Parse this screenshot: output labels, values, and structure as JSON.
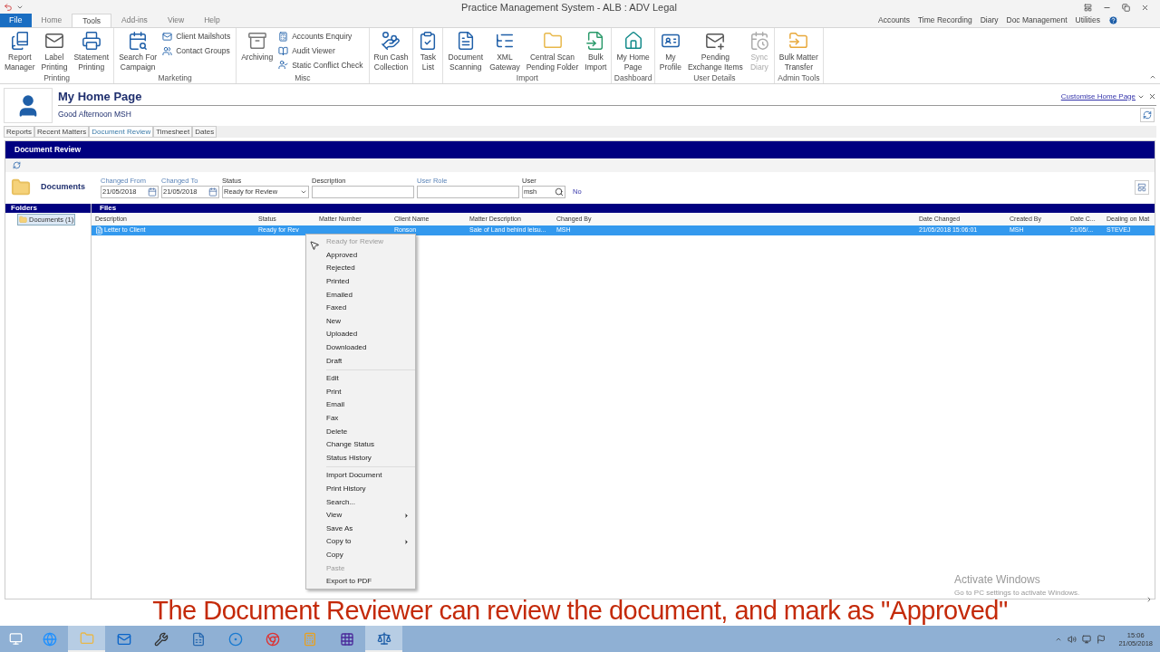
{
  "window": {
    "title": "Practice Management System - ALB : ADV Legal"
  },
  "menu_tabs": [
    {
      "label": "File",
      "kind": "file",
      "selected": false
    },
    {
      "label": "Home",
      "kind": "tab",
      "selected": false
    },
    {
      "label": "Tools",
      "kind": "tab",
      "selected": true
    },
    {
      "label": "Add-ins",
      "kind": "tab",
      "selected": false
    },
    {
      "label": "View",
      "kind": "tab",
      "selected": false
    },
    {
      "label": "Help",
      "kind": "tab",
      "selected": false
    }
  ],
  "right_links": [
    "Accounts",
    "Time Recording",
    "Diary",
    "Doc Management",
    "Utilities"
  ],
  "ribbon": [
    {
      "label": "Printing",
      "items": [
        {
          "kind": "large",
          "label": "Report\nManager",
          "disabled": false
        },
        {
          "kind": "large",
          "label": "Label\nPrinting",
          "disabled": false
        },
        {
          "kind": "large",
          "label": "Statement\nPrinting",
          "disabled": false
        }
      ]
    },
    {
      "label": "Marketing",
      "items": [
        {
          "kind": "large",
          "label": "Search For\nCampaign",
          "disabled": false
        },
        {
          "kind": "stack",
          "items": [
            "Client Mailshots",
            "Contact Groups"
          ]
        }
      ]
    },
    {
      "label": "Misc",
      "items": [
        {
          "kind": "large",
          "label": "Archiving",
          "disabled": false
        },
        {
          "kind": "stack",
          "items": [
            "Accounts Enquiry",
            "Audit Viewer",
            "Static Conflict Check"
          ]
        }
      ]
    },
    {
      "items": [
        {
          "kind": "large",
          "label": "Run Cash\nCollection",
          "disabled": false
        }
      ]
    },
    {
      "items": [
        {
          "kind": "large",
          "label": "Task\nList",
          "disabled": false
        }
      ]
    },
    {
      "label": "Import",
      "items": [
        {
          "kind": "large",
          "label": "Document\nScanning",
          "disabled": false
        },
        {
          "kind": "large",
          "label": "XML\nGateway",
          "disabled": false
        },
        {
          "kind": "large",
          "label": "Central Scan\nPending Folder",
          "disabled": false
        },
        {
          "kind": "large",
          "label": "Bulk\nImport",
          "disabled": false
        }
      ]
    },
    {
      "label": "Dashboard",
      "items": [
        {
          "kind": "large",
          "label": "My Home\nPage",
          "disabled": false
        }
      ]
    },
    {
      "label": "User Details",
      "items": [
        {
          "kind": "large",
          "label": "My\nProfile",
          "disabled": false
        },
        {
          "kind": "large",
          "label": "Pending\nExchange Items",
          "disabled": false
        },
        {
          "kind": "large",
          "label": "Sync\nDiary",
          "disabled": true
        }
      ]
    },
    {
      "label": "Admin Tools",
      "items": [
        {
          "kind": "large",
          "label": "Bulk Matter\nTransfer",
          "disabled": false
        }
      ]
    }
  ],
  "home": {
    "title": "My Home Page",
    "greeting": "Good Afternoon MSH",
    "customise_link": "Customise Home Page"
  },
  "home_tabs": [
    {
      "label": "Reports",
      "selected": false
    },
    {
      "label": "Recent Matters",
      "selected": false
    },
    {
      "label": "Document Review",
      "selected": true
    },
    {
      "label": "Timesheet",
      "selected": false
    },
    {
      "label": "Dates",
      "selected": false
    }
  ],
  "review": {
    "title": "Document Review",
    "documents_label": "Documents",
    "filters": [
      {
        "label": "Changed From",
        "kind": "date",
        "value": "21/05/2018",
        "enabled": true
      },
      {
        "label": "Changed To",
        "kind": "date",
        "value": "21/05/2018",
        "enabled": true
      },
      {
        "label": "Status",
        "kind": "select",
        "value": "Ready for Review",
        "enabled": false
      },
      {
        "label": "Description",
        "kind": "text",
        "enabled": false
      },
      {
        "label": "User Role",
        "kind": "text",
        "enabled": true
      },
      {
        "label": "User",
        "kind": "search",
        "value": "msh",
        "enabled": false
      }
    ],
    "no_link": "No",
    "folders_title": "Folders",
    "folders": [
      {
        "label": "Documents (1)",
        "selected": true
      }
    ],
    "files_title": "Files",
    "columns": [
      "Description",
      "Status",
      "Matter Number",
      "Client Name",
      "Matter Description",
      "Changed By",
      "Date Changed",
      "Created By",
      "Date C...",
      "Dealing on Mat"
    ],
    "rows": [
      {
        "selected": true,
        "cells": [
          "Letter to Client",
          "Ready for Rev",
          null,
          "Ronson",
          "Sale of Land behind leisu...",
          "MSH",
          "21/05/2018 15:06:01",
          "MSH",
          "21/05/...",
          "STEVEJ"
        ]
      }
    ]
  },
  "context_menu": [
    {
      "kind": "item",
      "label": "Ready for Review",
      "disabled": true,
      "submenu": false
    },
    {
      "kind": "item",
      "label": "Approved",
      "disabled": false,
      "submenu": false
    },
    {
      "kind": "item",
      "label": "Rejected",
      "disabled": false,
      "submenu": false
    },
    {
      "kind": "item",
      "label": "Printed",
      "disabled": false,
      "submenu": false
    },
    {
      "kind": "item",
      "label": "Emailed",
      "disabled": false,
      "submenu": false
    },
    {
      "kind": "item",
      "label": "Faxed",
      "disabled": false,
      "submenu": false
    },
    {
      "kind": "item",
      "label": "New",
      "disabled": false,
      "submenu": false
    },
    {
      "kind": "item",
      "label": "Uploaded",
      "disabled": false,
      "submenu": false
    },
    {
      "kind": "item",
      "label": "Downloaded",
      "disabled": false,
      "submenu": false
    },
    {
      "kind": "item",
      "label": "Draft",
      "disabled": false,
      "submenu": false
    },
    {
      "kind": "separator"
    },
    {
      "kind": "item",
      "label": "Edit",
      "disabled": false,
      "submenu": false
    },
    {
      "kind": "item",
      "label": "Print",
      "disabled": false,
      "submenu": false
    },
    {
      "kind": "item",
      "label": "Email",
      "disabled": false,
      "submenu": false
    },
    {
      "kind": "item",
      "label": "Fax",
      "disabled": false,
      "submenu": false
    },
    {
      "kind": "item",
      "label": "Delete",
      "disabled": false,
      "submenu": false
    },
    {
      "kind": "item",
      "label": "Change Status",
      "disabled": false,
      "submenu": false
    },
    {
      "kind": "item",
      "label": "Status History",
      "disabled": false,
      "submenu": false
    },
    {
      "kind": "separator"
    },
    {
      "kind": "item",
      "label": "Import Document",
      "disabled": false,
      "submenu": false
    },
    {
      "kind": "item",
      "label": "Print History",
      "disabled": false,
      "submenu": false
    },
    {
      "kind": "item",
      "label": "Search...",
      "disabled": false,
      "submenu": false
    },
    {
      "kind": "item",
      "label": "View",
      "disabled": false,
      "submenu": true
    },
    {
      "kind": "item",
      "label": "Save As",
      "disabled": false,
      "submenu": false
    },
    {
      "kind": "item",
      "label": "Copy to",
      "disabled": false,
      "submenu": true
    },
    {
      "kind": "item",
      "label": "Copy",
      "disabled": false,
      "submenu": false
    },
    {
      "kind": "item",
      "label": "Paste",
      "disabled": true,
      "submenu": false
    },
    {
      "kind": "item",
      "label": "Export to PDF",
      "disabled": false,
      "submenu": false
    }
  ],
  "watermark": {
    "title": "Activate Windows",
    "subtitle": "Go to PC settings to activate Windows."
  },
  "caption": "The Document Reviewer can review the document, and mark as \"Approved\"",
  "taskbar": {
    "apps": [
      {
        "selected": false
      },
      {
        "selected": true
      },
      {
        "selected": false
      },
      {
        "selected": false
      },
      {
        "selected": false
      },
      {
        "selected": false
      },
      {
        "selected": false
      },
      {
        "selected": false
      },
      {
        "selected": false
      },
      {
        "selected": true
      }
    ],
    "time": "15:06",
    "date": "21/05/2018"
  }
}
